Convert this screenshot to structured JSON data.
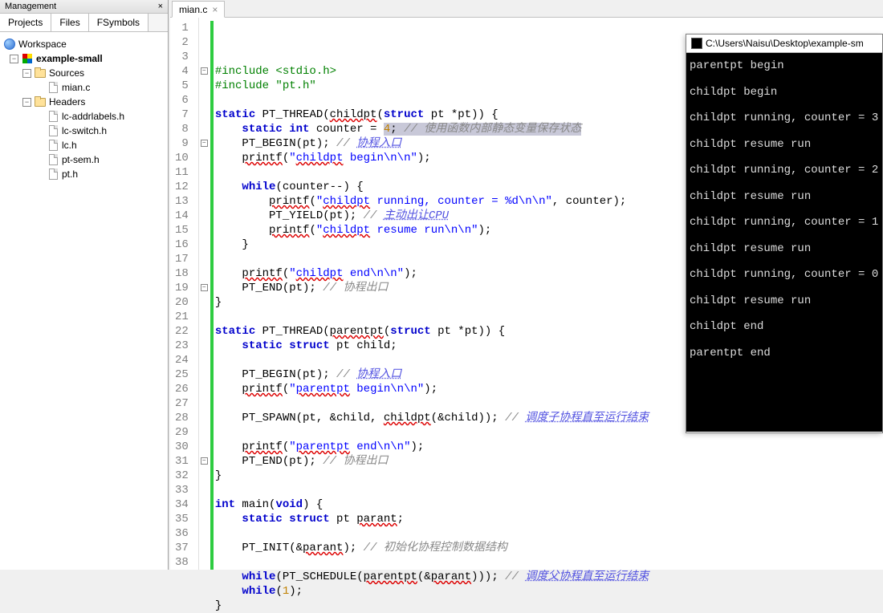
{
  "management": {
    "title": "Management"
  },
  "left_tabs": [
    "Projects",
    "Files",
    "FSymbols"
  ],
  "tree": {
    "workspace": "Workspace",
    "project": "example-small",
    "sources_label": "Sources",
    "sources": [
      "mian.c"
    ],
    "headers_label": "Headers",
    "headers": [
      "lc-addrlabels.h",
      "lc-switch.h",
      "lc.h",
      "pt-sem.h",
      "pt.h"
    ]
  },
  "editor_tab": "mian.c",
  "code": {
    "lines": [
      {
        "n": 1,
        "t": [
          {
            "c": "pp",
            "s": "#include <stdio.h>"
          }
        ]
      },
      {
        "n": 2,
        "t": [
          {
            "c": "pp",
            "s": "#include \"pt.h\""
          }
        ]
      },
      {
        "n": 3,
        "t": []
      },
      {
        "n": 4,
        "fold": true,
        "t": [
          {
            "c": "kw",
            "s": "static"
          },
          {
            "s": " PT_THREAD("
          },
          {
            "c": "err",
            "s": "childpt"
          },
          {
            "s": "("
          },
          {
            "c": "kw",
            "s": "struct"
          },
          {
            "s": " pt *pt)) {"
          }
        ]
      },
      {
        "n": 5,
        "t": [
          {
            "s": "    "
          },
          {
            "c": "kw",
            "s": "static int"
          },
          {
            "s": " counter = "
          },
          {
            "c": "num hl-sel",
            "s": "4"
          },
          {
            "c": "hl-sel",
            "s": "; "
          },
          {
            "c": "cm hl-sel",
            "s": "// 使用函数内部静态变量保存状态"
          }
        ]
      },
      {
        "n": 6,
        "t": [
          {
            "s": "    PT_BEGIN(pt); "
          },
          {
            "c": "cm",
            "s": "// "
          },
          {
            "c": "cmlink",
            "s": "协程入口"
          }
        ]
      },
      {
        "n": 7,
        "t": [
          {
            "s": "    "
          },
          {
            "c": "err",
            "s": "printf"
          },
          {
            "s": "("
          },
          {
            "c": "str",
            "s": "\""
          },
          {
            "c": "str err",
            "s": "childpt"
          },
          {
            "c": "str",
            "s": " begin\\n\\n\""
          },
          {
            "s": ");"
          }
        ]
      },
      {
        "n": 8,
        "t": []
      },
      {
        "n": 9,
        "fold": true,
        "t": [
          {
            "s": "    "
          },
          {
            "c": "kw",
            "s": "while"
          },
          {
            "s": "(counter--) {"
          }
        ]
      },
      {
        "n": 10,
        "t": [
          {
            "s": "        "
          },
          {
            "c": "err",
            "s": "printf"
          },
          {
            "s": "("
          },
          {
            "c": "str",
            "s": "\""
          },
          {
            "c": "str err",
            "s": "childpt"
          },
          {
            "c": "str",
            "s": " running, counter = %d\\n\\n\""
          },
          {
            "s": ", counter);"
          }
        ]
      },
      {
        "n": 11,
        "t": [
          {
            "s": "        PT_YIELD(pt); "
          },
          {
            "c": "cm",
            "s": "// "
          },
          {
            "c": "cmlink",
            "s": "主动出让CPU"
          }
        ]
      },
      {
        "n": 12,
        "t": [
          {
            "s": "        "
          },
          {
            "c": "err",
            "s": "printf"
          },
          {
            "s": "("
          },
          {
            "c": "str",
            "s": "\""
          },
          {
            "c": "str err",
            "s": "childpt"
          },
          {
            "c": "str",
            "s": " resume run\\n\\n\""
          },
          {
            "s": ");"
          }
        ]
      },
      {
        "n": 13,
        "t": [
          {
            "s": "    }"
          }
        ]
      },
      {
        "n": 14,
        "t": []
      },
      {
        "n": 15,
        "t": [
          {
            "s": "    "
          },
          {
            "c": "err",
            "s": "printf"
          },
          {
            "s": "("
          },
          {
            "c": "str",
            "s": "\""
          },
          {
            "c": "str err",
            "s": "childpt"
          },
          {
            "c": "str",
            "s": " end\\n\\n\""
          },
          {
            "s": ");"
          }
        ]
      },
      {
        "n": 16,
        "t": [
          {
            "s": "    PT_END(pt); "
          },
          {
            "c": "cm",
            "s": "// 协程出口"
          }
        ]
      },
      {
        "n": 17,
        "t": [
          {
            "s": "}"
          }
        ]
      },
      {
        "n": 18,
        "t": []
      },
      {
        "n": 19,
        "fold": true,
        "t": [
          {
            "c": "kw",
            "s": "static"
          },
          {
            "s": " PT_THREAD("
          },
          {
            "c": "err",
            "s": "parentpt"
          },
          {
            "s": "("
          },
          {
            "c": "kw",
            "s": "struct"
          },
          {
            "s": " pt *pt)) {"
          }
        ]
      },
      {
        "n": 20,
        "t": [
          {
            "s": "    "
          },
          {
            "c": "kw",
            "s": "static struct"
          },
          {
            "s": " pt child;"
          }
        ]
      },
      {
        "n": 21,
        "t": []
      },
      {
        "n": 22,
        "t": [
          {
            "s": "    PT_BEGIN(pt); "
          },
          {
            "c": "cm",
            "s": "// "
          },
          {
            "c": "cmlink",
            "s": "协程入口"
          }
        ]
      },
      {
        "n": 23,
        "t": [
          {
            "s": "    "
          },
          {
            "c": "err",
            "s": "printf"
          },
          {
            "s": "("
          },
          {
            "c": "str",
            "s": "\""
          },
          {
            "c": "str err",
            "s": "parentpt"
          },
          {
            "c": "str",
            "s": " begin\\n\\n\""
          },
          {
            "s": ");"
          }
        ]
      },
      {
        "n": 24,
        "t": []
      },
      {
        "n": 25,
        "t": [
          {
            "s": "    PT_SPAWN(pt, &child, "
          },
          {
            "c": "err",
            "s": "childpt"
          },
          {
            "s": "(&child)); "
          },
          {
            "c": "cm",
            "s": "// "
          },
          {
            "c": "cmlink",
            "s": "调度子协程直至运行结束"
          }
        ]
      },
      {
        "n": 26,
        "t": []
      },
      {
        "n": 27,
        "t": [
          {
            "s": "    "
          },
          {
            "c": "err",
            "s": "printf"
          },
          {
            "s": "("
          },
          {
            "c": "str",
            "s": "\""
          },
          {
            "c": "str err",
            "s": "parentpt"
          },
          {
            "c": "str",
            "s": " end\\n\\n\""
          },
          {
            "s": ");"
          }
        ]
      },
      {
        "n": 28,
        "t": [
          {
            "s": "    PT_END(pt); "
          },
          {
            "c": "cm",
            "s": "// 协程出口"
          }
        ]
      },
      {
        "n": 29,
        "t": [
          {
            "s": "}"
          }
        ]
      },
      {
        "n": 30,
        "t": []
      },
      {
        "n": 31,
        "fold": true,
        "t": [
          {
            "c": "kw",
            "s": "int"
          },
          {
            "s": " main("
          },
          {
            "c": "kw",
            "s": "void"
          },
          {
            "s": ") {"
          }
        ]
      },
      {
        "n": 32,
        "t": [
          {
            "s": "    "
          },
          {
            "c": "kw",
            "s": "static struct"
          },
          {
            "s": " pt "
          },
          {
            "c": "err",
            "s": "parant"
          },
          {
            "s": ";"
          }
        ]
      },
      {
        "n": 33,
        "t": []
      },
      {
        "n": 34,
        "t": [
          {
            "s": "    PT_INIT(&"
          },
          {
            "c": "err",
            "s": "parant"
          },
          {
            "s": "); "
          },
          {
            "c": "cm",
            "s": "// 初始化协程控制数据结构"
          }
        ]
      },
      {
        "n": 35,
        "t": []
      },
      {
        "n": 36,
        "t": [
          {
            "s": "    "
          },
          {
            "c": "kw",
            "s": "while"
          },
          {
            "s": "(PT_SCHEDULE("
          },
          {
            "c": "err",
            "s": "parentpt"
          },
          {
            "s": "(&"
          },
          {
            "c": "err",
            "s": "parant"
          },
          {
            "s": "))); "
          },
          {
            "c": "cm",
            "s": "// "
          },
          {
            "c": "cmlink",
            "s": "调度父协程直至运行结束"
          }
        ]
      },
      {
        "n": 37,
        "t": [
          {
            "s": "    "
          },
          {
            "c": "kw",
            "s": "while"
          },
          {
            "s": "("
          },
          {
            "c": "num",
            "s": "1"
          },
          {
            "s": ");"
          }
        ]
      },
      {
        "n": 38,
        "t": [
          {
            "s": "}"
          }
        ]
      }
    ]
  },
  "console": {
    "title": "C:\\Users\\Naisu\\Desktop\\example-sm",
    "lines": [
      "parentpt begin",
      "childpt begin",
      "childpt running, counter = 3",
      "childpt resume run",
      "childpt running, counter = 2",
      "childpt resume run",
      "childpt running, counter = 1",
      "childpt resume run",
      "childpt running, counter = 0",
      "childpt resume run",
      "childpt end",
      "parentpt end"
    ]
  }
}
